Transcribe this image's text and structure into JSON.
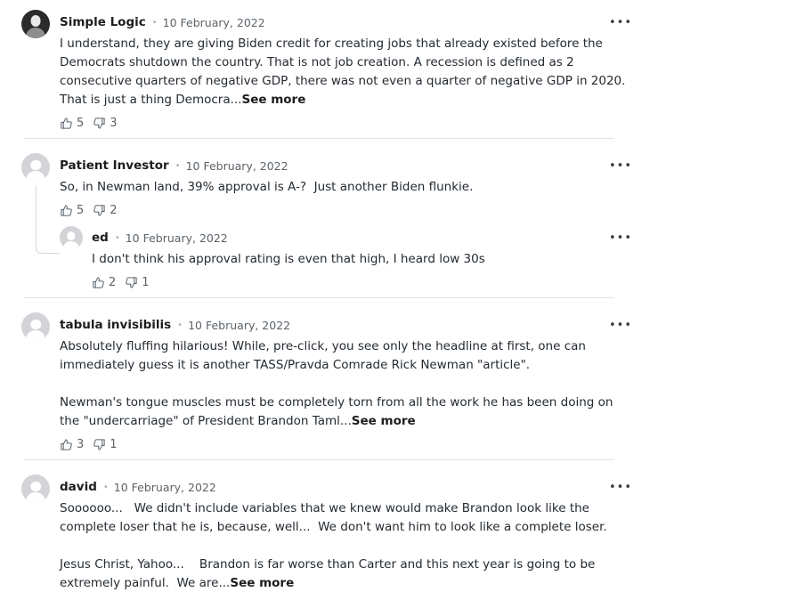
{
  "comments": [
    {
      "author": "Simple Logic",
      "date": "10 February, 2022",
      "text": "I understand, they are giving Biden credit for creating jobs that already existed before the Democrats shutdown the country. That is not job creation. A recession is defined as 2 consecutive quarters of negative GDP, there was not even a quarter of negative GDP in 2020. That is just a thing Democra...",
      "see_more": "See more",
      "likes": "5",
      "dislikes": "3"
    },
    {
      "author": "Patient Investor",
      "date": "10 February, 2022",
      "text": "So, in Newman land, 39% approval is A-?  Just another Biden flunkie.",
      "likes": "5",
      "dislikes": "2",
      "reply": {
        "author": "ed",
        "date": "10 February, 2022",
        "text": "I don't think his approval rating is even that high, I heard low 30s",
        "likes": "2",
        "dislikes": "1"
      }
    },
    {
      "author": "tabula invisibilis",
      "date": "10 February, 2022",
      "text": "Absolutely fluffing hilarious! While, pre-click, you see only the headline at first, one can immediately guess it is another TASS/Pravda Comrade Rick Newman \"article\".\n\nNewman's tongue muscles must be completely torn from all the work he has been doing on the \"undercarriage\" of President Brandon Taml...",
      "see_more": "See more",
      "likes": "3",
      "dislikes": "1"
    },
    {
      "author": "david",
      "date": "10 February, 2022",
      "text": "Soooooo...   We didn't include variables that we knew would make Brandon look like the complete loser that he is, because, well...  We don't want him to look like a complete loser.\n\nJesus Christ, Yahoo...    Brandon is far worse than Carter and this next year is going to be extremely painful.  We are...",
      "see_more": "See more"
    }
  ],
  "ui": {
    "more_glyph": "•••",
    "sep_glyph": "•",
    "icons": [
      "thumbs-up-icon",
      "thumbs-down-icon",
      "more-options-icon",
      "user-avatar-icon"
    ]
  }
}
